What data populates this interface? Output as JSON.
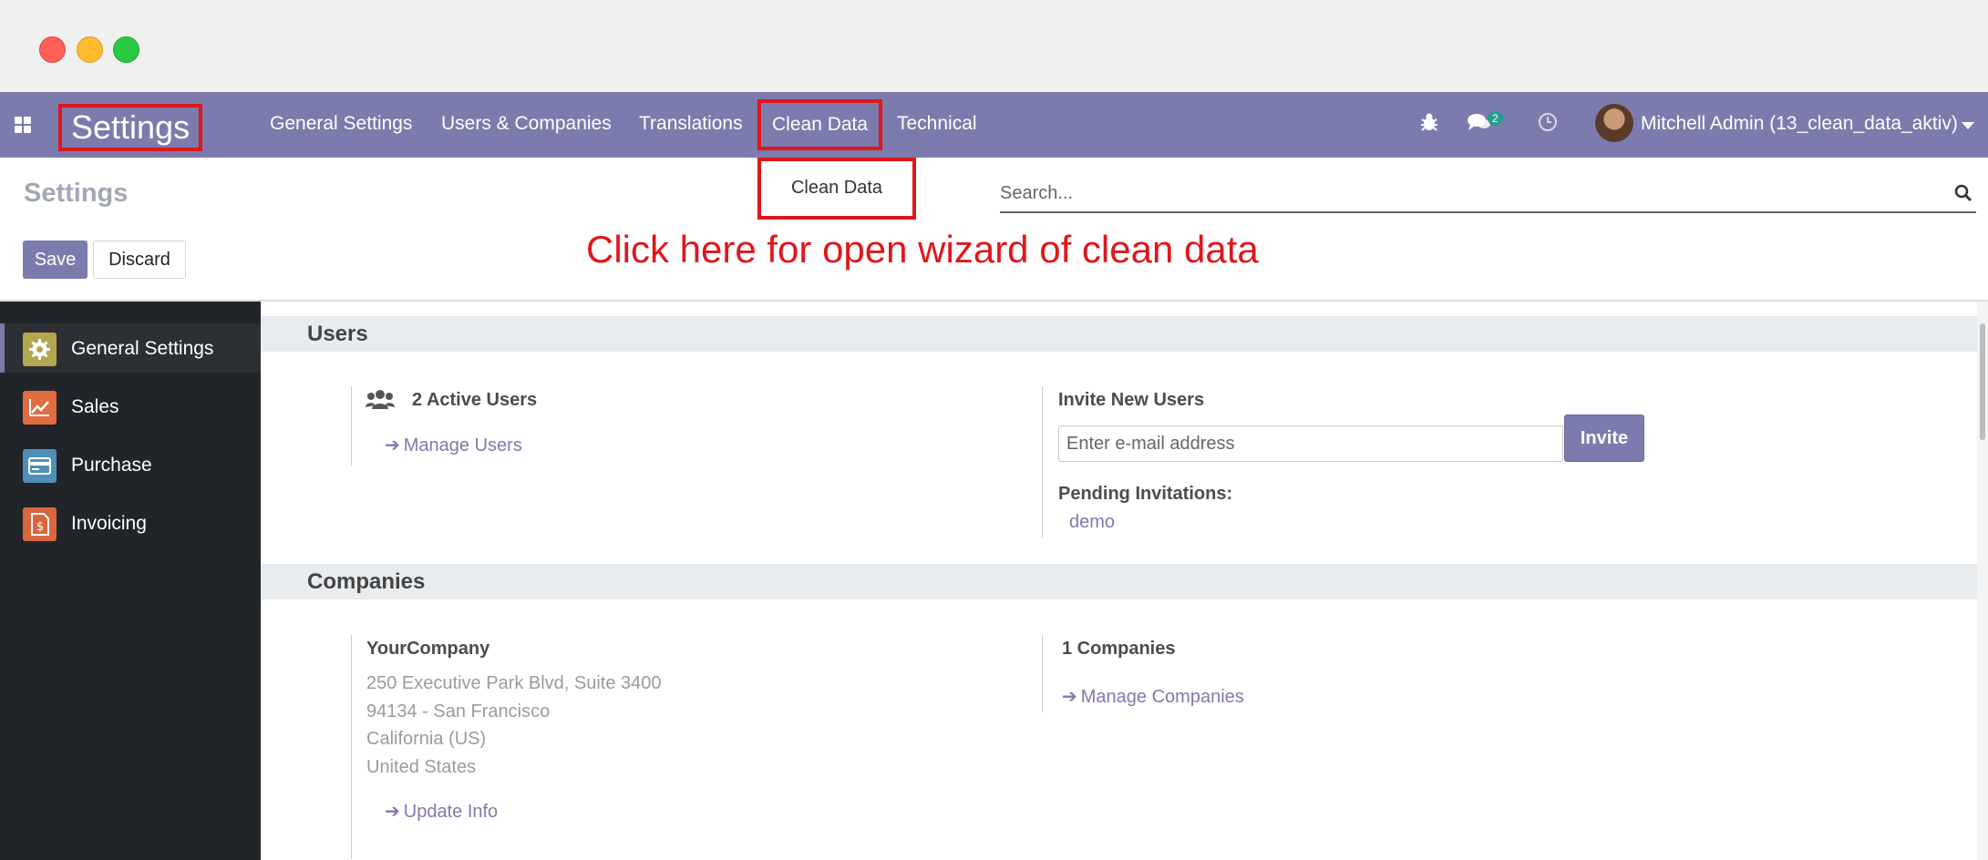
{
  "navbar": {
    "brand": "Settings",
    "menu": [
      "General Settings",
      "Users & Companies",
      "Translations",
      "Clean Data",
      "Technical"
    ],
    "messages_badge": "2",
    "user": "Mitchell Admin (13_clean_data_aktiv)"
  },
  "dropdown": {
    "item": "Clean Data"
  },
  "control_panel": {
    "title": "Settings",
    "save_label": "Save",
    "discard_label": "Discard",
    "search_placeholder": "Search..."
  },
  "annotation": "Click here for open wizard of clean data",
  "sidebar": {
    "items": [
      {
        "label": "General Settings",
        "icon": "gear-icon",
        "color": "#b4a64e"
      },
      {
        "label": "Sales",
        "icon": "chart-icon",
        "color": "#e06c3f"
      },
      {
        "label": "Purchase",
        "icon": "card-icon",
        "color": "#4f8fb5"
      },
      {
        "label": "Invoicing",
        "icon": "invoice-icon",
        "color": "#d9673b"
      }
    ]
  },
  "users": {
    "heading": "Users",
    "active_users": "2 Active Users",
    "manage_users": "Manage Users",
    "invite_heading": "Invite New Users",
    "email_placeholder": "Enter e-mail address",
    "invite_label": "Invite",
    "pending_heading": "Pending Invitations:",
    "pending": [
      "demo"
    ]
  },
  "companies": {
    "heading": "Companies",
    "company_name": "YourCompany",
    "address": [
      "250 Executive Park Blvd, Suite 3400",
      "94134 - San Francisco",
      "California (US)",
      "United States"
    ],
    "update_info": "Update Info",
    "count": "1 Companies",
    "manage_companies": "Manage Companies"
  },
  "colors": {
    "brand": "#7c7bad",
    "highlight": "#e0161a",
    "sidebar_bg": "#212529"
  }
}
